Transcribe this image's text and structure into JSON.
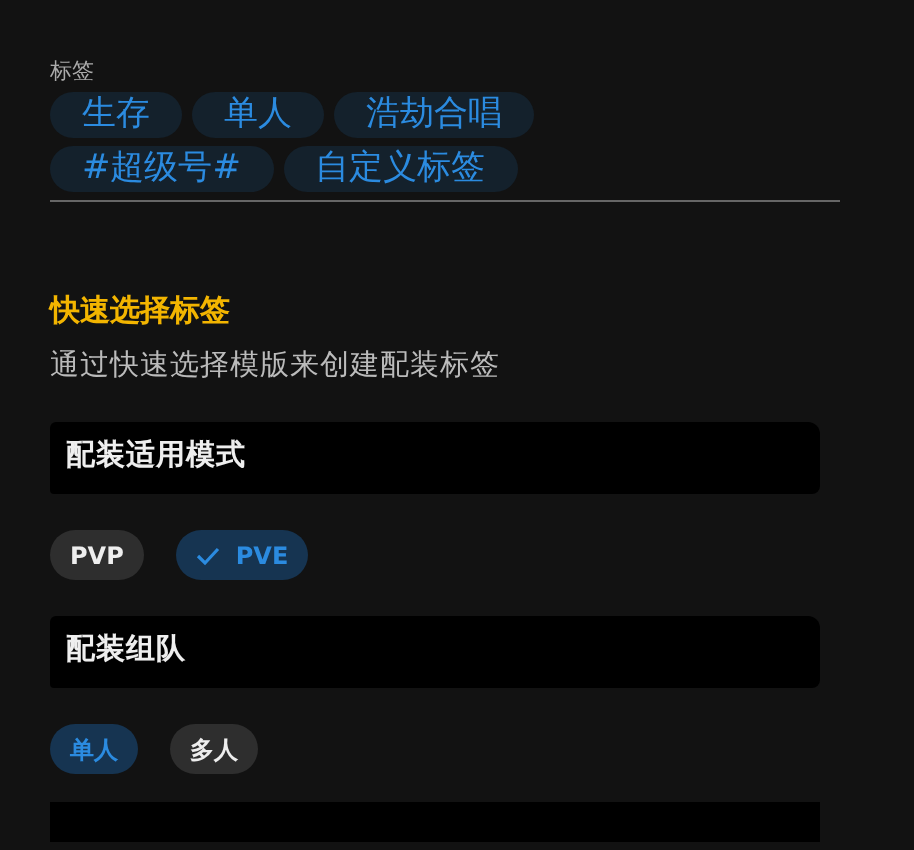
{
  "tags": {
    "label": "标签",
    "items": [
      "生存",
      "单人",
      "浩劫合唱",
      "#超级号#",
      "自定义标签"
    ]
  },
  "quick_select": {
    "title": "快速选择标签",
    "description": "通过快速选择模版来创建配装标签",
    "groups": [
      {
        "title": "配装适用模式",
        "options": [
          {
            "label": "PVP",
            "selected": false,
            "check": false
          },
          {
            "label": "PVE",
            "selected": true,
            "check": true
          }
        ]
      },
      {
        "title": "配装组队",
        "options": [
          {
            "label": "单人",
            "selected": true,
            "check": false
          },
          {
            "label": "多人",
            "selected": false,
            "check": false
          }
        ]
      }
    ]
  }
}
